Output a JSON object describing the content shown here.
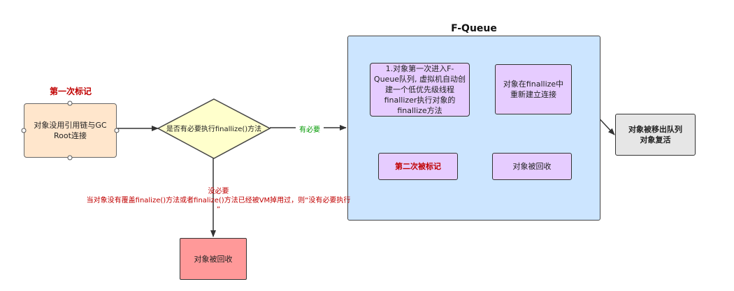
{
  "diagram": {
    "container_title": "F-Queue",
    "first_mark_label": "第一次标记",
    "start_node": "对象没用引用链与GC Root连接",
    "decision_node": "是否有必要执行finallize()方法",
    "yes_label": "有必要",
    "no_label_line1": "没必要",
    "no_label_line2": "当对象没有覆盖finalize()方法或者finalize()方法已经被VM掉用过，则“没有必要执行 ”",
    "fqueue_node": "1.对象第一次进入F-Queue队列, 虚拟机自动创建一个低优先级线程finallizer执行对象的finallize方法",
    "relink_node": "对象在finallize中重新建立连接",
    "second_mark_node": "第二次被标记",
    "collected_node": "对象被回收",
    "escape_node_line1": "对象被移出队列",
    "escape_node_line2": "对象复活",
    "final_collected_node": "对象被回收"
  },
  "colors": {
    "start_fill": "#ffe6cc",
    "decision_fill": "#ffffcc",
    "container_fill": "#cce5ff",
    "queue_node_fill": "#e6ccff",
    "escape_fill": "#e6e6e6",
    "final_fill": "#ff9999",
    "accent_red": "#c00000",
    "accent_green": "#009900"
  }
}
